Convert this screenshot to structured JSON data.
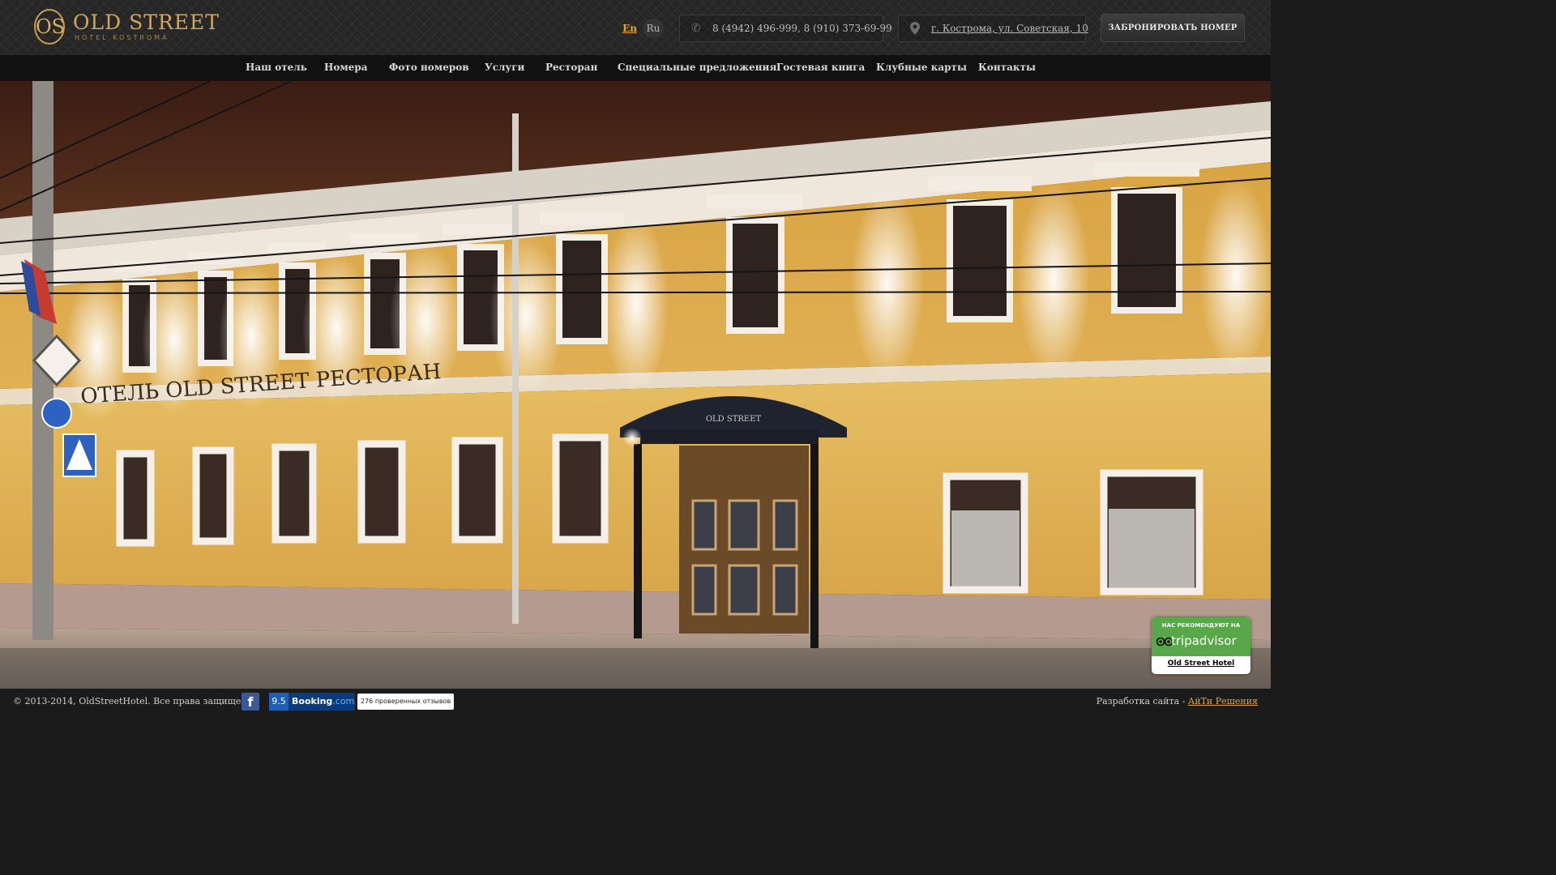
{
  "header": {
    "logo": {
      "monogram": "OS",
      "name": "OLD STREET",
      "subtitle": "HOTEL KOSTROMA"
    },
    "languages": [
      "En",
      "Ru"
    ],
    "phone": "8 (4942) 496-999, 8 (910) 373-69-99",
    "address": "г. Кострома, ул. Советская, 10",
    "book_button": "ЗАБРОНИРОВАТЬ НОМЕР",
    "icons": {
      "phone": "phone-icon",
      "address": "map-pin-icon"
    }
  },
  "nav": {
    "items": [
      "Наш отель",
      "Номера",
      "Фото номеров",
      "Услуги",
      "Ресторан",
      "Специальные предложения",
      "Гостевая книга",
      "Клубные карты",
      "Контакты"
    ]
  },
  "hero": {
    "facade_sign": "ОТЕЛЬ  OLD STREET  РЕСТОРАН",
    "canopy_sign": "OLD STREET"
  },
  "footer": {
    "copyright": "© 2013-2014, OldStreetHotel. Все права защищены.",
    "facebook": "f",
    "booking_score": "9.5",
    "booking_name": "Booking",
    "booking_tld": ".com",
    "reviews": "276 проверенных отзывов",
    "dev_prefix": "Разработка сайта - ",
    "dev_link": "АйТи Решения"
  },
  "tripadvisor": {
    "recommend": "НАС РЕКОМЕНДУЮТ НА",
    "brand": "tripadvisor",
    "hotel": "Old Street Hotel"
  },
  "colors": {
    "accent": "#e0a53c",
    "gold": "#d1a75a",
    "facade": "#d9a443",
    "tripadvisor": "#58a84a",
    "booking": "#0c3b7c"
  }
}
